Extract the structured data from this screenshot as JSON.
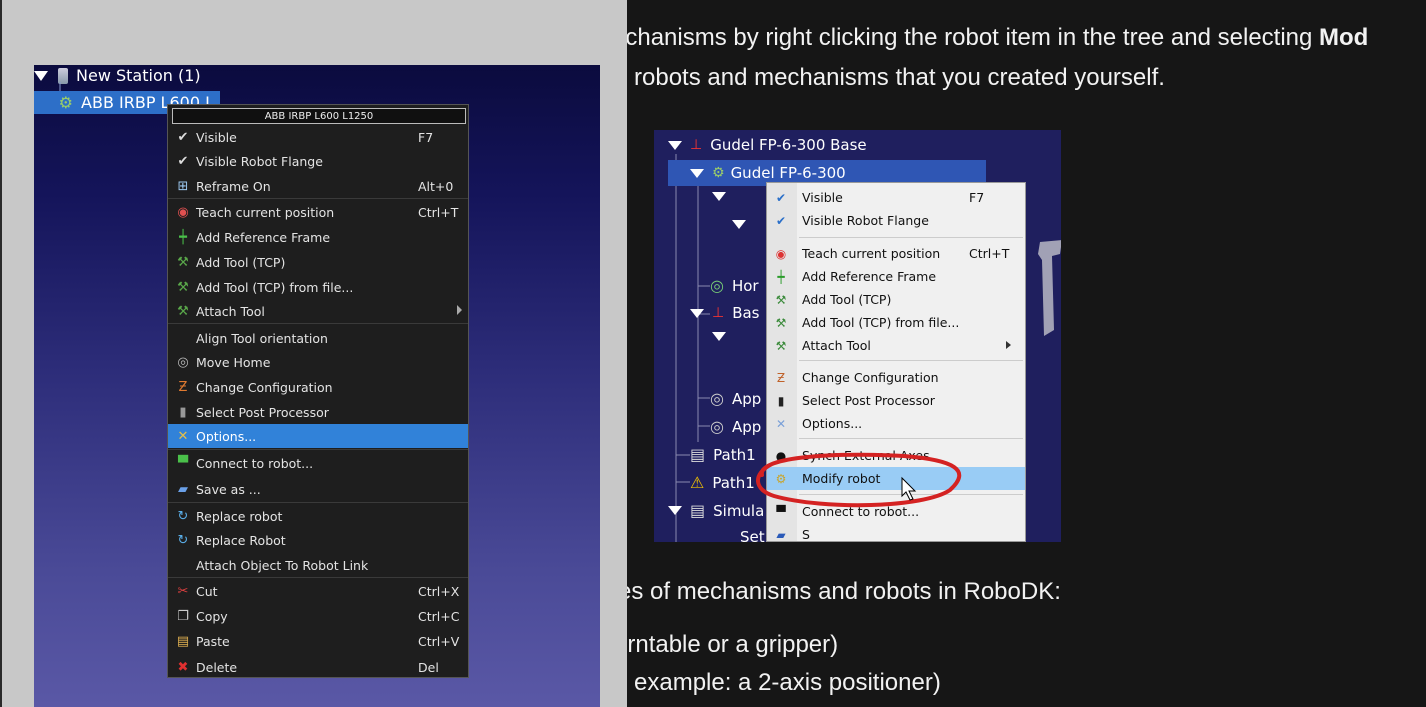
{
  "article": {
    "line1_prefix": "echanisms by right clicking the robot item in the tree and selecting ",
    "line1_bold": "Mod",
    "line2": "robots and mechanisms that you created yourself.",
    "line3": "es of mechanisms and robots in RoboDK:",
    "line4": "urntable or a gripper)",
    "line5": "example: a 2-axis positioner)"
  },
  "left_tree": {
    "station": "New Station (1)",
    "robot": "ABB IRBP L600 L"
  },
  "context_menu": {
    "title": "ABB IRBP L600 L1250",
    "items": [
      {
        "icon": "check-icon",
        "label": "Visible",
        "shortcut": "F7"
      },
      {
        "icon": "check-icon",
        "label": "Visible Robot Flange",
        "shortcut": ""
      },
      {
        "icon": "reframe-icon",
        "label": "Reframe On",
        "shortcut": "Alt+0"
      },
      {
        "icon": "teach-target-icon",
        "label": "Teach current position",
        "shortcut": "Ctrl+T"
      },
      {
        "icon": "reference-frame-icon",
        "label": "Add Reference Frame",
        "shortcut": ""
      },
      {
        "icon": "tool-icon",
        "label": "Add Tool (TCP)",
        "shortcut": ""
      },
      {
        "icon": "tool-icon",
        "label": "Add Tool (TCP) from file...",
        "shortcut": ""
      },
      {
        "icon": "tool-icon",
        "label": "Attach Tool",
        "shortcut": ""
      },
      {
        "icon": "",
        "label": "Align Tool orientation",
        "shortcut": ""
      },
      {
        "icon": "home-target-icon",
        "label": "Move Home",
        "shortcut": ""
      },
      {
        "icon": "configuration-icon",
        "label": "Change Configuration",
        "shortcut": ""
      },
      {
        "icon": "post-processor-icon",
        "label": "Select Post Processor",
        "shortcut": ""
      },
      {
        "icon": "options-icon",
        "label": "Options...",
        "shortcut": ""
      },
      {
        "icon": "connect-icon",
        "label": "Connect to robot...",
        "shortcut": ""
      },
      {
        "icon": "save-icon",
        "label": "Save as ...",
        "shortcut": ""
      },
      {
        "icon": "replace-icon",
        "label": "Replace robot",
        "shortcut": ""
      },
      {
        "icon": "replace-icon",
        "label": "Replace Robot",
        "shortcut": ""
      },
      {
        "icon": "",
        "label": "Attach Object To Robot Link",
        "shortcut": ""
      },
      {
        "icon": "cut-icon",
        "label": "Cut",
        "shortcut": "Ctrl+X"
      },
      {
        "icon": "copy-icon",
        "label": "Copy",
        "shortcut": "Ctrl+C"
      },
      {
        "icon": "paste-icon",
        "label": "Paste",
        "shortcut": "Ctrl+V"
      },
      {
        "icon": "delete-icon",
        "label": "Delete",
        "shortcut": "Del"
      }
    ]
  },
  "screenshot": {
    "tree": {
      "base": "Gudel FP-6-300 Base",
      "robot": "Gudel FP-6-300",
      "hor": "Hor",
      "bas": "Bas",
      "app1": "App",
      "app2": "App",
      "path1": "Path1",
      "path2": "Path1",
      "simula": "Simula",
      "set": "Set"
    },
    "menu": {
      "items": [
        {
          "label": "Visible",
          "shortcut": "F7"
        },
        {
          "label": "Visible Robot Flange",
          "shortcut": ""
        },
        {
          "label": "Teach current position",
          "shortcut": "Ctrl+T"
        },
        {
          "label": "Add Reference Frame",
          "shortcut": ""
        },
        {
          "label": "Add Tool (TCP)",
          "shortcut": ""
        },
        {
          "label": "Add Tool (TCP) from file...",
          "shortcut": ""
        },
        {
          "label": "Attach Tool",
          "shortcut": ""
        },
        {
          "label": "Change Configuration",
          "shortcut": ""
        },
        {
          "label": "Select Post Processor",
          "shortcut": ""
        },
        {
          "label": "Options...",
          "shortcut": ""
        },
        {
          "label": "Synch External Axes",
          "shortcut": ""
        },
        {
          "label": "Modify robot",
          "shortcut": ""
        },
        {
          "label": "Connect to robot...",
          "shortcut": ""
        },
        {
          "label": "S",
          "shortcut": ""
        }
      ]
    },
    "highlight_color": "#d42222"
  }
}
